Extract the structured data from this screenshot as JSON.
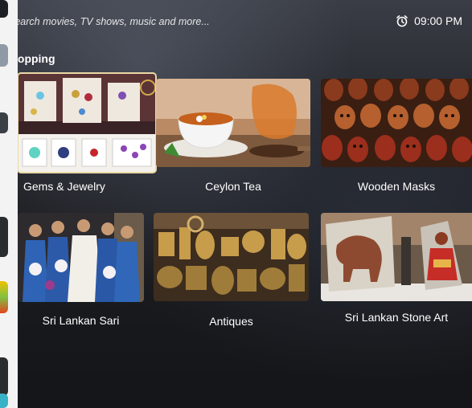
{
  "header": {
    "search_placeholder": "Search movies, TV shows, music and more...",
    "time": "09:00 PM",
    "clock_icon": "alarm-clock-icon"
  },
  "section": {
    "title": "Shopping"
  },
  "tiles": [
    {
      "label": "Gems & Jewelry",
      "focused": true
    },
    {
      "label": "Ceylon Tea"
    },
    {
      "label": "Wooden Masks"
    },
    {
      "label": "Sri Lankan Sari"
    },
    {
      "label": "Antiques"
    },
    {
      "label": "Sri Lankan Stone Art"
    }
  ],
  "colors": {
    "focus_border": "#ead9a6",
    "text": "#ffffff"
  }
}
